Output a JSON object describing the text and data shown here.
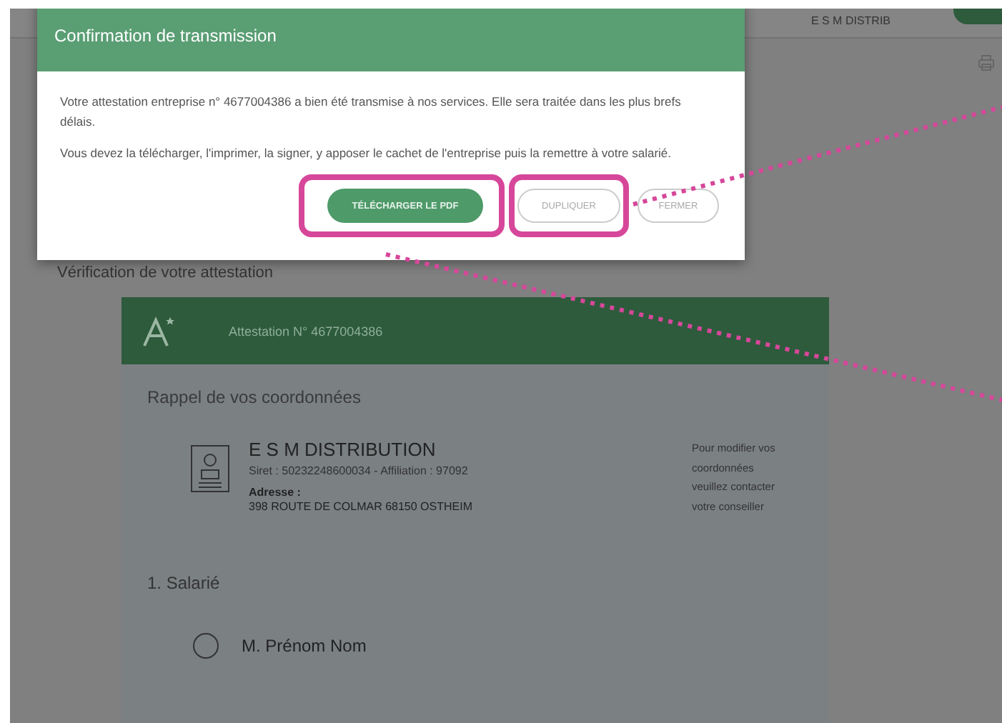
{
  "top_bar": {
    "account": "E S M DISTRIB"
  },
  "dialog": {
    "title": "Confirmation de transmission",
    "paragraphs": [
      "Votre attestation entreprise n° 4677004386 a bien été transmise à nos services. Elle sera traitée dans les plus brefs délais.",
      "Vous devez la télécharger, l'imprimer, la signer, y apposer le cachet de l'entreprise puis la remettre à votre salarié."
    ],
    "buttons": [
      {
        "label": "TÉLÉCHARGER LE PDF",
        "kind": "primary",
        "highlighted": true
      },
      {
        "label": "DUPLIQUER",
        "kind": "outline",
        "highlighted": true
      },
      {
        "label": "FERMER",
        "kind": "outline",
        "highlighted": false
      }
    ]
  },
  "page_title": "Vérification de votre attestation",
  "card": {
    "header": "Attestation N° 4677004386",
    "section": "Rappel de vos coordonnées",
    "company": {
      "name": "E S M DISTRIBUTION",
      "ids": "Siret : 50232248600034 - Affiliation : 97092",
      "address_label": "Adresse :",
      "address": "398 ROUTE DE COLMAR 68150 OSTHEIM"
    },
    "note": "Pour modifier vos coordonnées veuillez contacter votre conseiller",
    "step": "1. Salarié",
    "employee": {
      "name": "M. Prénom Nom",
      "selected": false
    }
  }
}
